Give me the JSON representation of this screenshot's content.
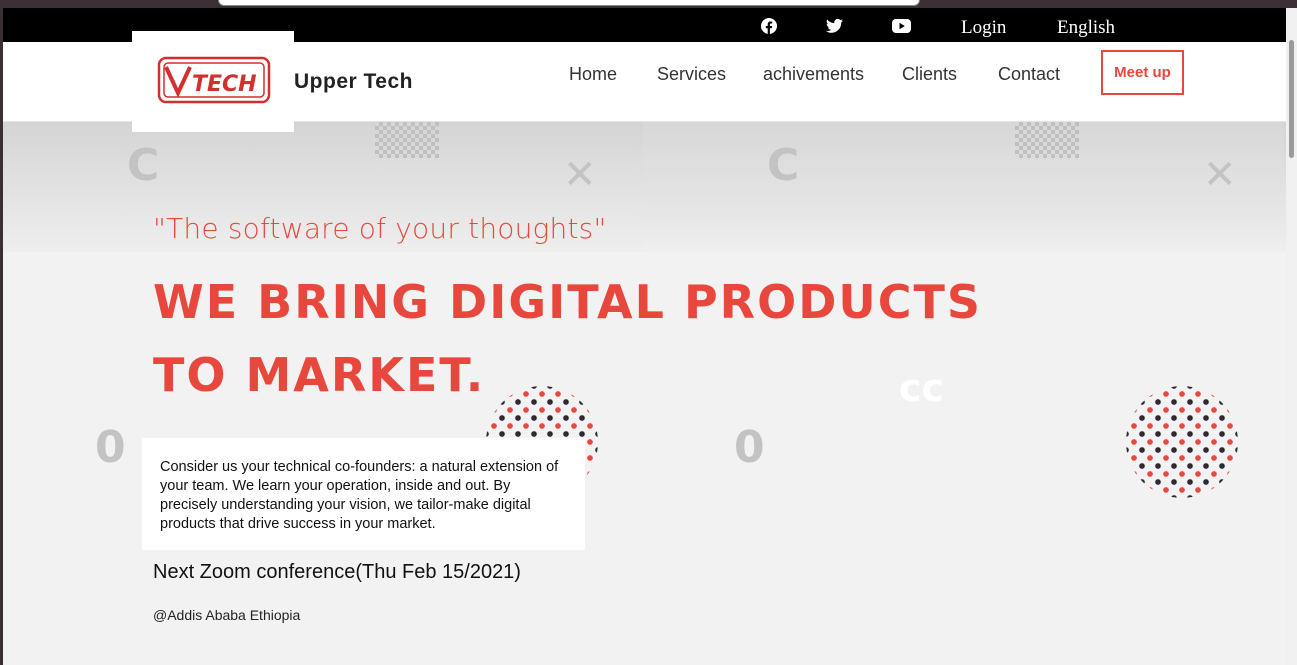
{
  "topbar": {
    "icons": [
      "facebook-icon",
      "twitter-icon",
      "youtube-icon"
    ],
    "login_label": "Login",
    "language_label": "English"
  },
  "header": {
    "logo_text": "TECH",
    "brand_name": "Upper Tech",
    "nav": {
      "home": "Home",
      "services": "Services",
      "achievements": "achivements",
      "clients": "Clients",
      "contact": "Contact"
    },
    "cta_label": "Meet up"
  },
  "hero": {
    "quote": "\"The software of your thoughts\"",
    "headline_line1": "We bring digital products",
    "headline_line2": "to market.",
    "description": "Consider us your technical co-founders: a natural extension of your team. We learn your operation, inside and out. By precisely understanding your vision, we tailor-make digital products that drive success in your market.",
    "event": "Next Zoom conference(Thu Feb 15/2021)",
    "location": "@Addis Ababa Ethiopia"
  },
  "colors": {
    "accent": "#e8473d",
    "topbar_bg": "#000000",
    "hero_bg": "#f2f2f2"
  }
}
